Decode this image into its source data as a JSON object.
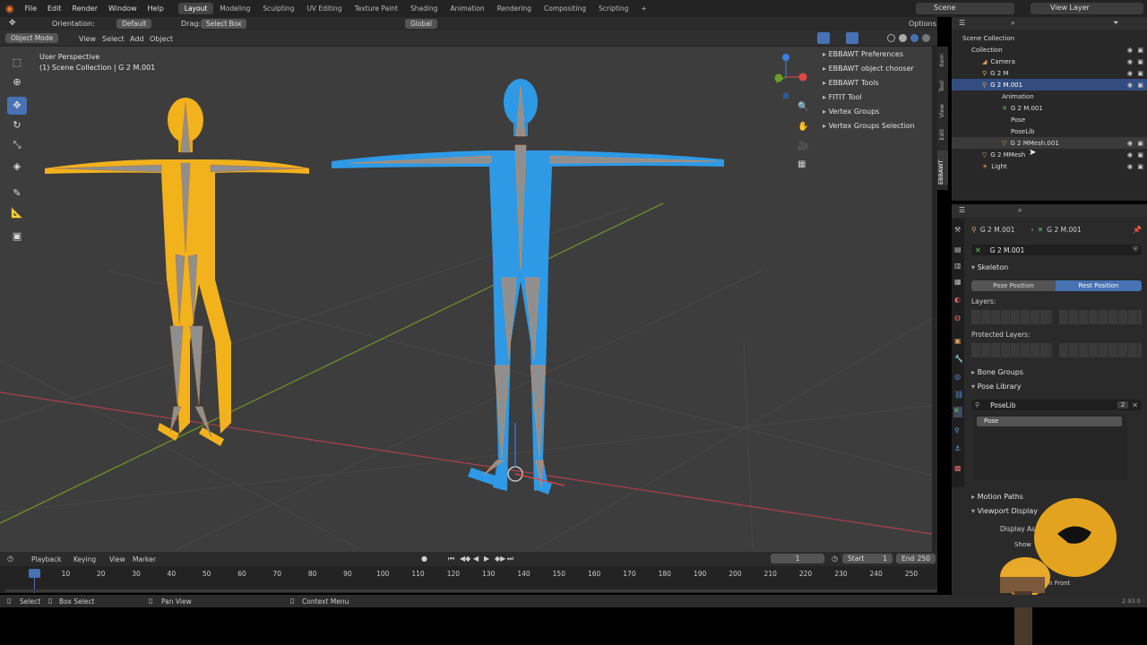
{
  "topbar": {
    "menus": [
      "File",
      "Edit",
      "Render",
      "Window",
      "Help"
    ],
    "workspaces": [
      "Layout",
      "Modeling",
      "Sculpting",
      "UV Editing",
      "Texture Paint",
      "Shading",
      "Animation",
      "Rendering",
      "Compositing",
      "Scripting"
    ],
    "active_workspace": "Layout",
    "add_tab": "+",
    "scene": "Scene",
    "view_layer": "View Layer"
  },
  "tool_header": {
    "orientation_label": "Orientation:",
    "orientation_value": "Default",
    "drag_label": "Drag:",
    "drag_value": "Select Box",
    "transform_orientation": "Global",
    "options": "Options"
  },
  "viewport_header": {
    "mode": "Object Mode",
    "menus": [
      "View",
      "Select",
      "Add",
      "Object"
    ]
  },
  "viewport": {
    "perspective": "User Perspective",
    "collection_info": "(1) Scene Collection | G 2 M.001",
    "npanel_items": [
      "EBBAWT Preferences",
      "EBBAWT object chooser",
      "EBBAWT Tools",
      "FITIT Tool",
      "Vertex Groups",
      "Vertex Groups Selection"
    ],
    "side_tabs": [
      "Item",
      "Tool",
      "View",
      "Edit",
      "EBBAWT"
    ],
    "gizmo_axes": [
      "X",
      "Y",
      "Z"
    ]
  },
  "outliner": {
    "rows": [
      {
        "label": "Scene Collection",
        "indent": 0
      },
      {
        "label": "Collection",
        "indent": 1
      },
      {
        "label": "Camera",
        "indent": 2
      },
      {
        "label": "G 2 M",
        "indent": 2
      },
      {
        "label": "G 2 M.001",
        "indent": 2
      },
      {
        "label": "Animation",
        "indent": 3
      },
      {
        "label": "G 2 M.001",
        "indent": 3
      },
      {
        "label": "Pose",
        "indent": 3
      },
      {
        "label": "PoseLib",
        "indent": 3
      },
      {
        "label": "G 2 MMesh.001",
        "indent": 3
      },
      {
        "label": "G 2 MMesh",
        "indent": 2
      },
      {
        "label": "Light",
        "indent": 2
      }
    ]
  },
  "properties": {
    "breadcrumb_object": "G 2 M.001",
    "breadcrumb_data": "G 2 M.001",
    "data_name": "G 2 M.001",
    "skeleton_label": "Skeleton",
    "pose_position": "Pose Position",
    "rest_position": "Rest Position",
    "layers_label": "Layers:",
    "protected_layers_label": "Protected Layers:",
    "bone_groups": "Bone Groups",
    "pose_library": "Pose Library",
    "poselib_name": "PoseLib",
    "poselib_users": "2",
    "pose_item": "Pose",
    "motion_paths": "Motion Paths",
    "viewport_display": "Viewport Display",
    "display_as": "Display As",
    "show": "Show",
    "in_front": "In Front"
  },
  "timeline": {
    "menus": [
      "Playback",
      "Keying",
      "View",
      "Marker"
    ],
    "current_frame": "1",
    "start_label": "Start",
    "start": "1",
    "end_label": "End",
    "end": "250",
    "ticks": [
      "1",
      "10",
      "20",
      "30",
      "40",
      "50",
      "60",
      "70",
      "80",
      "90",
      "100",
      "110",
      "120",
      "130",
      "140",
      "150",
      "160",
      "170",
      "180",
      "190",
      "200",
      "210",
      "220",
      "230",
      "240",
      "250"
    ]
  },
  "statusbar": {
    "select": "Select",
    "box_select": "Box Select",
    "pan_view": "Pan View",
    "context_menu": "Context Menu",
    "version": "2.93.0"
  },
  "colors": {
    "accent": "#4772b3",
    "yellow_model": "#f2b21c",
    "blue_model": "#2e9ae6",
    "bones": "#8f8f8f",
    "bone_outline": "#e08a4a"
  }
}
